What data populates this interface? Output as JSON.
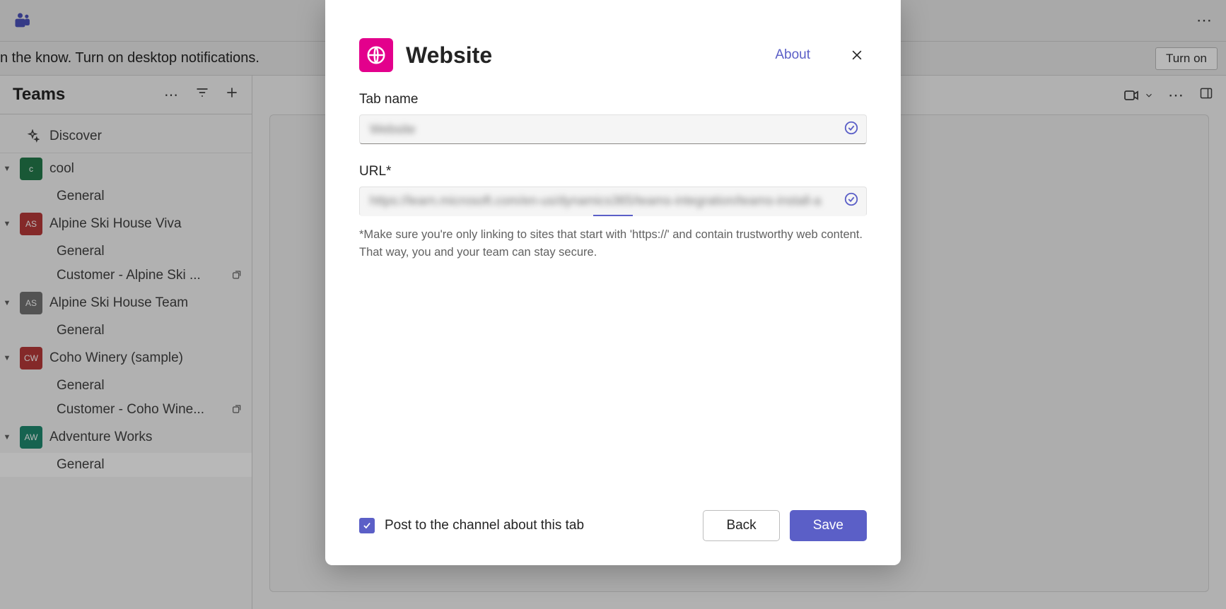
{
  "topbar": {
    "notifications_text": "n the know. Turn on desktop notifications.",
    "turn_on": "Turn on"
  },
  "sidebar": {
    "title": "Teams",
    "discover": "Discover",
    "teams": [
      {
        "name": "cool",
        "initials": "c",
        "color": "#237b4b",
        "channels": [
          {
            "name": "General"
          }
        ]
      },
      {
        "name": "Alpine Ski House Viva",
        "initials": "AS",
        "color": "#b73a3a",
        "channels": [
          {
            "name": "General"
          },
          {
            "name": "Customer - Alpine Ski ...",
            "linked": true
          }
        ]
      },
      {
        "name": "Alpine Ski House Team",
        "initials": "AS",
        "color": "#737373",
        "channels": [
          {
            "name": "General"
          }
        ]
      },
      {
        "name": "Coho Winery (sample)",
        "initials": "CW",
        "color": "#b73a3a",
        "channels": [
          {
            "name": "General"
          },
          {
            "name": "Customer - Coho Wine...",
            "linked": true
          }
        ]
      },
      {
        "name": "Adventure Works",
        "initials": "AW",
        "color": "#1f8a70",
        "channels": [
          {
            "name": "General",
            "active": true
          }
        ]
      }
    ]
  },
  "dialog": {
    "title": "Website",
    "about": "About",
    "tab_name_label": "Tab name",
    "tab_name_value": "Website",
    "url_label": "URL*",
    "url_value": "https://learn.microsoft.com/en-us/dynamics365/teams-integration/teams-install-a",
    "helper": "*Make sure you're only linking to sites that start with 'https://' and contain trustworthy web content. That way, you and your team can stay secure.",
    "post_label": "Post to the channel about this tab",
    "back": "Back",
    "save": "Save"
  }
}
